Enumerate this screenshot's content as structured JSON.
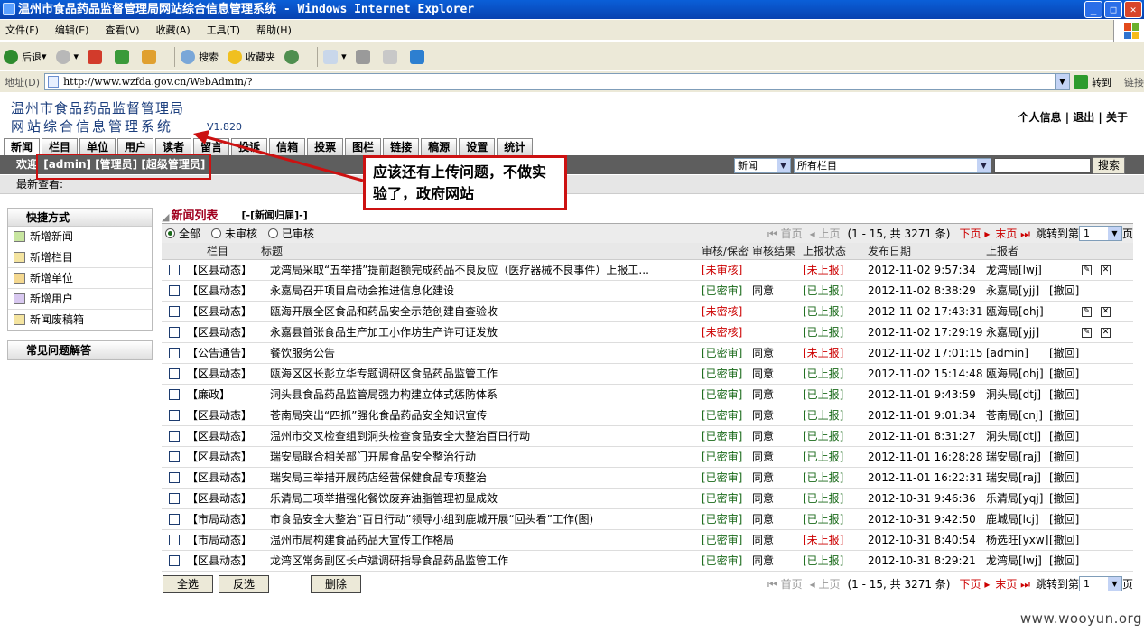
{
  "window": {
    "title": "温州市食品药品监督管理局网站综合信息管理系统 - Windows Internet Explorer"
  },
  "menu": [
    "文件(F)",
    "编辑(E)",
    "查看(V)",
    "收藏(A)",
    "工具(T)",
    "帮助(H)"
  ],
  "toolbar": {
    "back": "后退",
    "search": "搜索",
    "favorites": "收藏夹"
  },
  "address": {
    "label": "地址(D)",
    "url": "http://www.wzfda.gov.cn/WebAdmin/?",
    "go": "转到",
    "links": "链接"
  },
  "header": {
    "title_line1": "温州市食品药品监督管理局",
    "title_line2": "网站综合信息管理系统",
    "version": "V1.820",
    "top_links": "个人信息 | 退出 | 关于"
  },
  "tabs": [
    "新闻",
    "栏目",
    "单位",
    "用户",
    "读者",
    "留言",
    "投诉",
    "信箱",
    "投票",
    "图栏",
    "链接",
    "稿源",
    "设置",
    "统计"
  ],
  "userbar": {
    "welcome": "欢迎",
    "roles": "[admin] [管理员] [超级管理员]",
    "type_select": "新闻",
    "column_select": "所有栏目",
    "search_button": "搜索"
  },
  "recent": "最新查看:",
  "annotation": "应该还有上传问题，不做实验了，政府网站",
  "sidebar": {
    "shortcuts_title": "快捷方式",
    "items": [
      "新增新闻",
      "新增栏目",
      "新增单位",
      "新增用户",
      "新闻废稿箱"
    ],
    "faq_title": "常见问题解答"
  },
  "list": {
    "title": "新闻列表",
    "archive": "[-[新闻归届]-]",
    "filters": [
      "全部",
      "未审核",
      "已审核"
    ],
    "pager": {
      "first": "首页",
      "prev": "上页",
      "range": "(1 - 15, 共 3271 条)",
      "next": "下页",
      "last": "末页",
      "jump": "跳转到第",
      "page": "1",
      "unit": "页"
    },
    "columns": [
      "栏目",
      "标题",
      "审核/保密",
      "审核结果",
      "上报状态",
      "发布日期",
      "上报者"
    ],
    "rows": [
      {
        "col": "【区县动态】",
        "title": "龙湾局采取“五举措”提前超额完成药品不良反应（医疗器械不良事件）上报工...",
        "audit": "[未审核]",
        "result": "",
        "report": "[未上报]",
        "date": "2012-11-02 9:57:34",
        "reporter": "龙湾局[lwj]",
        "act": "icons"
      },
      {
        "col": "【区县动态】",
        "title": "永嘉局召开项目启动会推进信息化建设",
        "audit": "[已密审]",
        "result": "同意",
        "report": "[已上报]",
        "date": "2012-11-02 8:38:29",
        "reporter": "永嘉局[yjj]",
        "act": "[撤回]"
      },
      {
        "col": "【区县动态】",
        "title": "瓯海开展全区食品和药品安全示范创建自查验收",
        "audit": "[未密核]",
        "result": "",
        "report": "[已上报]",
        "date": "2012-11-02 17:43:31",
        "reporter": "瓯海局[ohj]",
        "act": "icons"
      },
      {
        "col": "【区县动态】",
        "title": "永嘉县首张食品生产加工小作坊生产许可证发放",
        "audit": "[未密核]",
        "result": "",
        "report": "[已上报]",
        "date": "2012-11-02 17:29:19",
        "reporter": "永嘉局[yjj]",
        "act": "icons"
      },
      {
        "col": "【公告通告】",
        "title": "餐饮服务公告",
        "audit": "[已密审]",
        "result": "同意",
        "report": "[未上报]",
        "date": "2012-11-02 17:01:15",
        "reporter": "[admin]",
        "act": "[撤回]"
      },
      {
        "col": "【区县动态】",
        "title": "瓯海区区长彭立华专题调研区食品药品监管工作",
        "audit": "[已密审]",
        "result": "同意",
        "report": "[已上报]",
        "date": "2012-11-02 15:14:48",
        "reporter": "瓯海局[ohj]",
        "act": "[撤回]"
      },
      {
        "col": "【廉政】",
        "title": "洞头县食品药品监管局强力构建立体式惩防体系",
        "audit": "[已密审]",
        "result": "同意",
        "report": "[已上报]",
        "date": "2012-11-01 9:43:59",
        "reporter": "洞头局[dtj]",
        "act": "[撤回]"
      },
      {
        "col": "【区县动态】",
        "title": "苍南局突出“四抓”强化食品药品安全知识宣传",
        "audit": "[已密审]",
        "result": "同意",
        "report": "[已上报]",
        "date": "2012-11-01 9:01:34",
        "reporter": "苍南局[cnj]",
        "act": "[撤回]"
      },
      {
        "col": "【区县动态】",
        "title": "温州市交叉检查组到洞头检查食品安全大整治百日行动",
        "audit": "[已密审]",
        "result": "同意",
        "report": "[已上报]",
        "date": "2012-11-01 8:31:27",
        "reporter": "洞头局[dtj]",
        "act": "[撤回]"
      },
      {
        "col": "【区县动态】",
        "title": "瑞安局联合相关部门开展食品安全整治行动",
        "audit": "[已密审]",
        "result": "同意",
        "report": "[已上报]",
        "date": "2012-11-01 16:28:28",
        "reporter": "瑞安局[raj]",
        "act": "[撤回]"
      },
      {
        "col": "【区县动态】",
        "title": "瑞安局三举措开展药店经营保健食品专项整治",
        "audit": "[已密审]",
        "result": "同意",
        "report": "[已上报]",
        "date": "2012-11-01 16:22:31",
        "reporter": "瑞安局[raj]",
        "act": "[撤回]"
      },
      {
        "col": "【区县动态】",
        "title": "乐清局三项举措强化餐饮废弃油脂管理初显成效",
        "audit": "[已密审]",
        "result": "同意",
        "report": "[已上报]",
        "date": "2012-10-31 9:46:36",
        "reporter": "乐清局[yqj]",
        "act": "[撤回]"
      },
      {
        "col": "【市局动态】",
        "title": "市食品安全大整治“百日行动”领导小组到鹿城开展“回头看”工作(图)",
        "audit": "[已密审]",
        "result": "同意",
        "report": "[已上报]",
        "date": "2012-10-31 9:42:50",
        "reporter": "鹿城局[lcj]",
        "act": "[撤回]"
      },
      {
        "col": "【市局动态】",
        "title": "温州市局构建食品药品大宣传工作格局",
        "audit": "[已密审]",
        "result": "同意",
        "report": "[未上报]",
        "date": "2012-10-31 8:40:54",
        "reporter": "杨选旺[yxw]",
        "act": "[撤回]"
      },
      {
        "col": "【区县动态】",
        "title": "龙湾区常务副区长卢斌调研指导食品药品监管工作",
        "audit": "[已密审]",
        "result": "同意",
        "report": "[已上报]",
        "date": "2012-10-31 8:29:21",
        "reporter": "龙湾局[lwj]",
        "act": "[撤回]"
      }
    ],
    "buttons": {
      "select_all": "全选",
      "invert": "反选",
      "delete": "删除"
    }
  },
  "watermark": "www.wooyun.org"
}
